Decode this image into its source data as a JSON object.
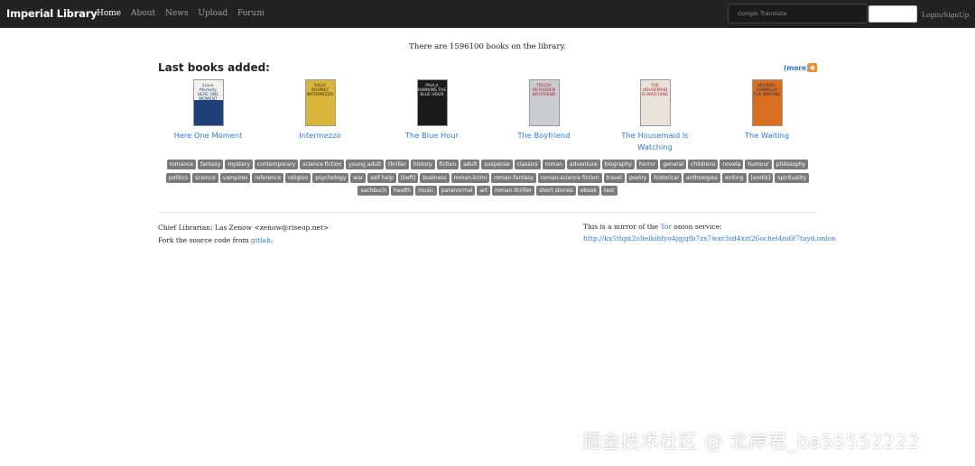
{
  "navbar": {
    "brand": "Imperial Library",
    "links": [
      "Home",
      "About",
      "News",
      "Upload",
      "Forum"
    ],
    "translate_placeholder": "Google Translate",
    "login_label": "Login/SignUp"
  },
  "count_text": "There are 1596100 books on the library.",
  "last_books": {
    "title": "Last books added:",
    "more_label": "(more)",
    "books": [
      {
        "title": "Here One Moment",
        "cover_text": "Liane Moriarty HERE ONE MOMENT",
        "cover_color": "#1d3f7a"
      },
      {
        "title": "Intermezzo",
        "cover_text": "SALLY ROONEY INTERMEZZO",
        "cover_color": "#d9b53a"
      },
      {
        "title": "The Blue Hour",
        "cover_text": "PAULA HAWKINS THE BLUE HOUR",
        "cover_color": "#1a1a1a"
      },
      {
        "title": "The Boyfriend",
        "cover_text": "FREIDA McFADDEN BOYFRIEND",
        "cover_color": "#c9ccd1"
      },
      {
        "title": "The Housemaid Is Watching",
        "cover_text": "THE HOUSEMAID IS WATCHING",
        "cover_color": "#e9e2d8"
      },
      {
        "title": "The Waiting",
        "cover_text": "MICHAEL CONNELLY THE WAITING",
        "cover_color": "#d96f1e"
      }
    ]
  },
  "tags": [
    "romance",
    "fantasy",
    "mystery",
    "contemporary",
    "science fiction",
    "young adult",
    "thriller",
    "history",
    "fiction",
    "adult",
    "suspense",
    "classics",
    "roman",
    "adventure",
    "biography",
    "horror",
    "general",
    "childrens",
    "novela",
    "humour",
    "philosophy",
    "politics",
    "science",
    "vampires",
    "reference",
    "religion",
    "psychology",
    "war",
    "self help",
    "[beft]",
    "business",
    "roman-krimi",
    "roman-fantasy",
    "roman-science fiction",
    "travel",
    "poetry",
    "historical",
    "anthologies",
    "writing",
    "[erotik]",
    "spirituality",
    "sachbuch",
    "health",
    "music",
    "paranormal",
    "art",
    "roman-thriller",
    "short stories",
    "ebook",
    "test"
  ],
  "footer": {
    "librarian": "Chief Librarian: Las Zenow <zenow@riseup.net>",
    "fork_prefix": "Fork the source code from",
    "fork_link": "gitlab",
    "fork_suffix": ".",
    "mirror_prefix": "This is a mirror of the",
    "mirror_link": "Tor",
    "mirror_suffix": "onion service:",
    "onion_url": "http://kx5thpx2olielkihfyo4jgjqfb7zx7wxr3sd4xzt26ochei4m6f7tayd.onion"
  },
  "watermark": "掘金技术社区 @ 北岸君_ba55552222"
}
